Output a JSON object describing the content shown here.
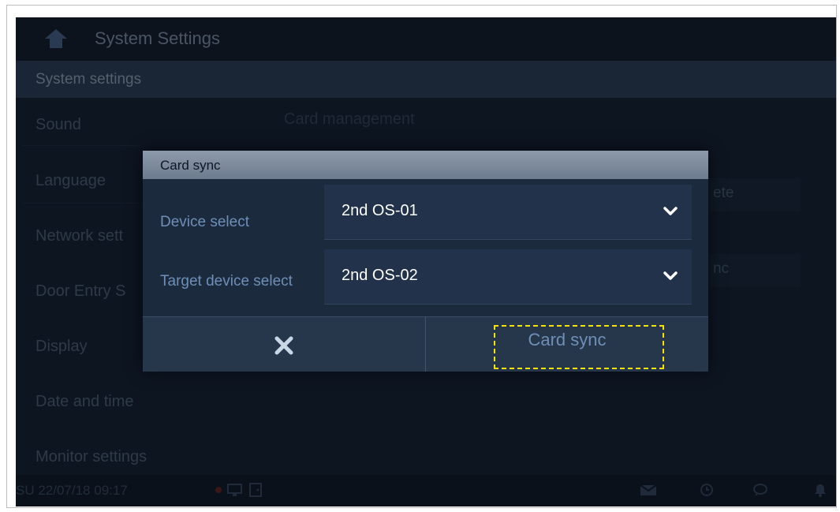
{
  "header": {
    "title": "System Settings"
  },
  "section": {
    "title": "System settings"
  },
  "menu": {
    "items": [
      {
        "label": "Sound"
      },
      {
        "label": "Language"
      },
      {
        "label": "Network sett"
      },
      {
        "label": "Door Entry S"
      },
      {
        "label": "Display"
      },
      {
        "label": "Date and time"
      },
      {
        "label": "Monitor settings"
      }
    ]
  },
  "content": {
    "card_management": "Card management",
    "delete_partial": "ete",
    "sync_partial": "nc"
  },
  "status": {
    "datetime": "SU 22/07/18  09:17"
  },
  "dialog": {
    "title": "Card sync",
    "device_label": "Device select",
    "device_value": "2nd OS-01",
    "target_label": "Target device select",
    "target_value": "2nd OS-02",
    "confirm_label": "Card sync"
  },
  "colors": {
    "highlight": "#f5e300",
    "label_blue": "#6e8fb8",
    "dialog_bg": "#1c2a3d"
  }
}
